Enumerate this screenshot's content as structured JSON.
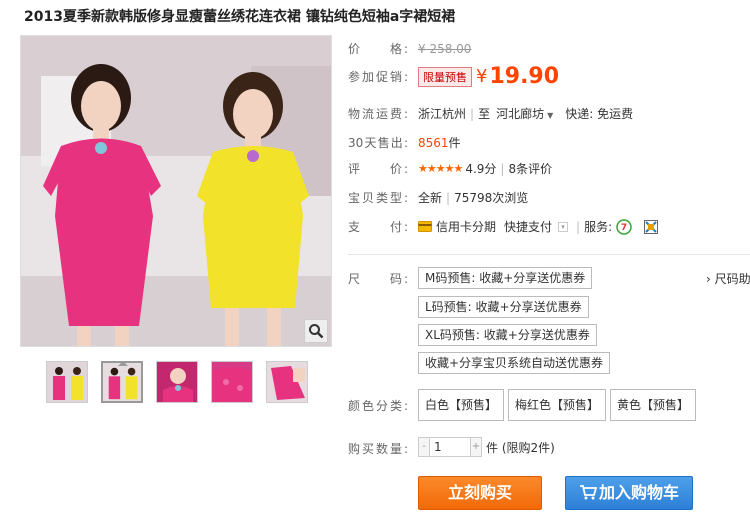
{
  "title": "2013夏季新款韩版修身显瘦蕾丝绣花连衣裙 镶钻纯色短袖a字裙短裙",
  "price": {
    "label": "价　　格:",
    "original": "¥ 258.00"
  },
  "promo": {
    "label": "参加促销:",
    "badge": "限量预售",
    "currency": "¥",
    "value": "19.90"
  },
  "shipping": {
    "label": "物流运费:",
    "from": "浙江杭州",
    "to_prefix": "至",
    "to": "河北廊坊",
    "express": "快递: 免运费"
  },
  "sales": {
    "label": "30天售出:",
    "count": "8561",
    "unit": "件"
  },
  "rating": {
    "label": "评　　价:",
    "stars": "★★★★★",
    "score": "4.9分",
    "reviews": "8条评价"
  },
  "type": {
    "label": "宝贝类型:",
    "condition": "全新",
    "views": "75798次浏览"
  },
  "payment": {
    "label": "支　　付:",
    "credit": "信用卡分期",
    "quick": "快捷支付",
    "service_label": "服务:"
  },
  "size": {
    "label": "尺　　码:",
    "guide": "› 尺码助",
    "options": [
      "M码预售: 收藏+分享送优惠券",
      "L码预售: 收藏+分享送优惠券",
      "XL码预售: 收藏+分享送优惠券",
      "收藏+分享宝贝系统自动送优惠券"
    ]
  },
  "color": {
    "label": "颜色分类:",
    "options": [
      "白色【预售】",
      "梅红色【预售】",
      "黄色【预售】"
    ]
  },
  "quantity": {
    "label": "购买数量:",
    "minus": "-",
    "value": "1",
    "plus": "+",
    "unit": "件 (限购2件)"
  },
  "buttons": {
    "buy": "立刻购买",
    "cart": "加入购物车"
  },
  "colors": {
    "accent": "#ff4400",
    "buy": "#f26a08",
    "cart": "#2c7fd6",
    "dress_pink": "#e6327f",
    "dress_yellow": "#f2e22a"
  }
}
